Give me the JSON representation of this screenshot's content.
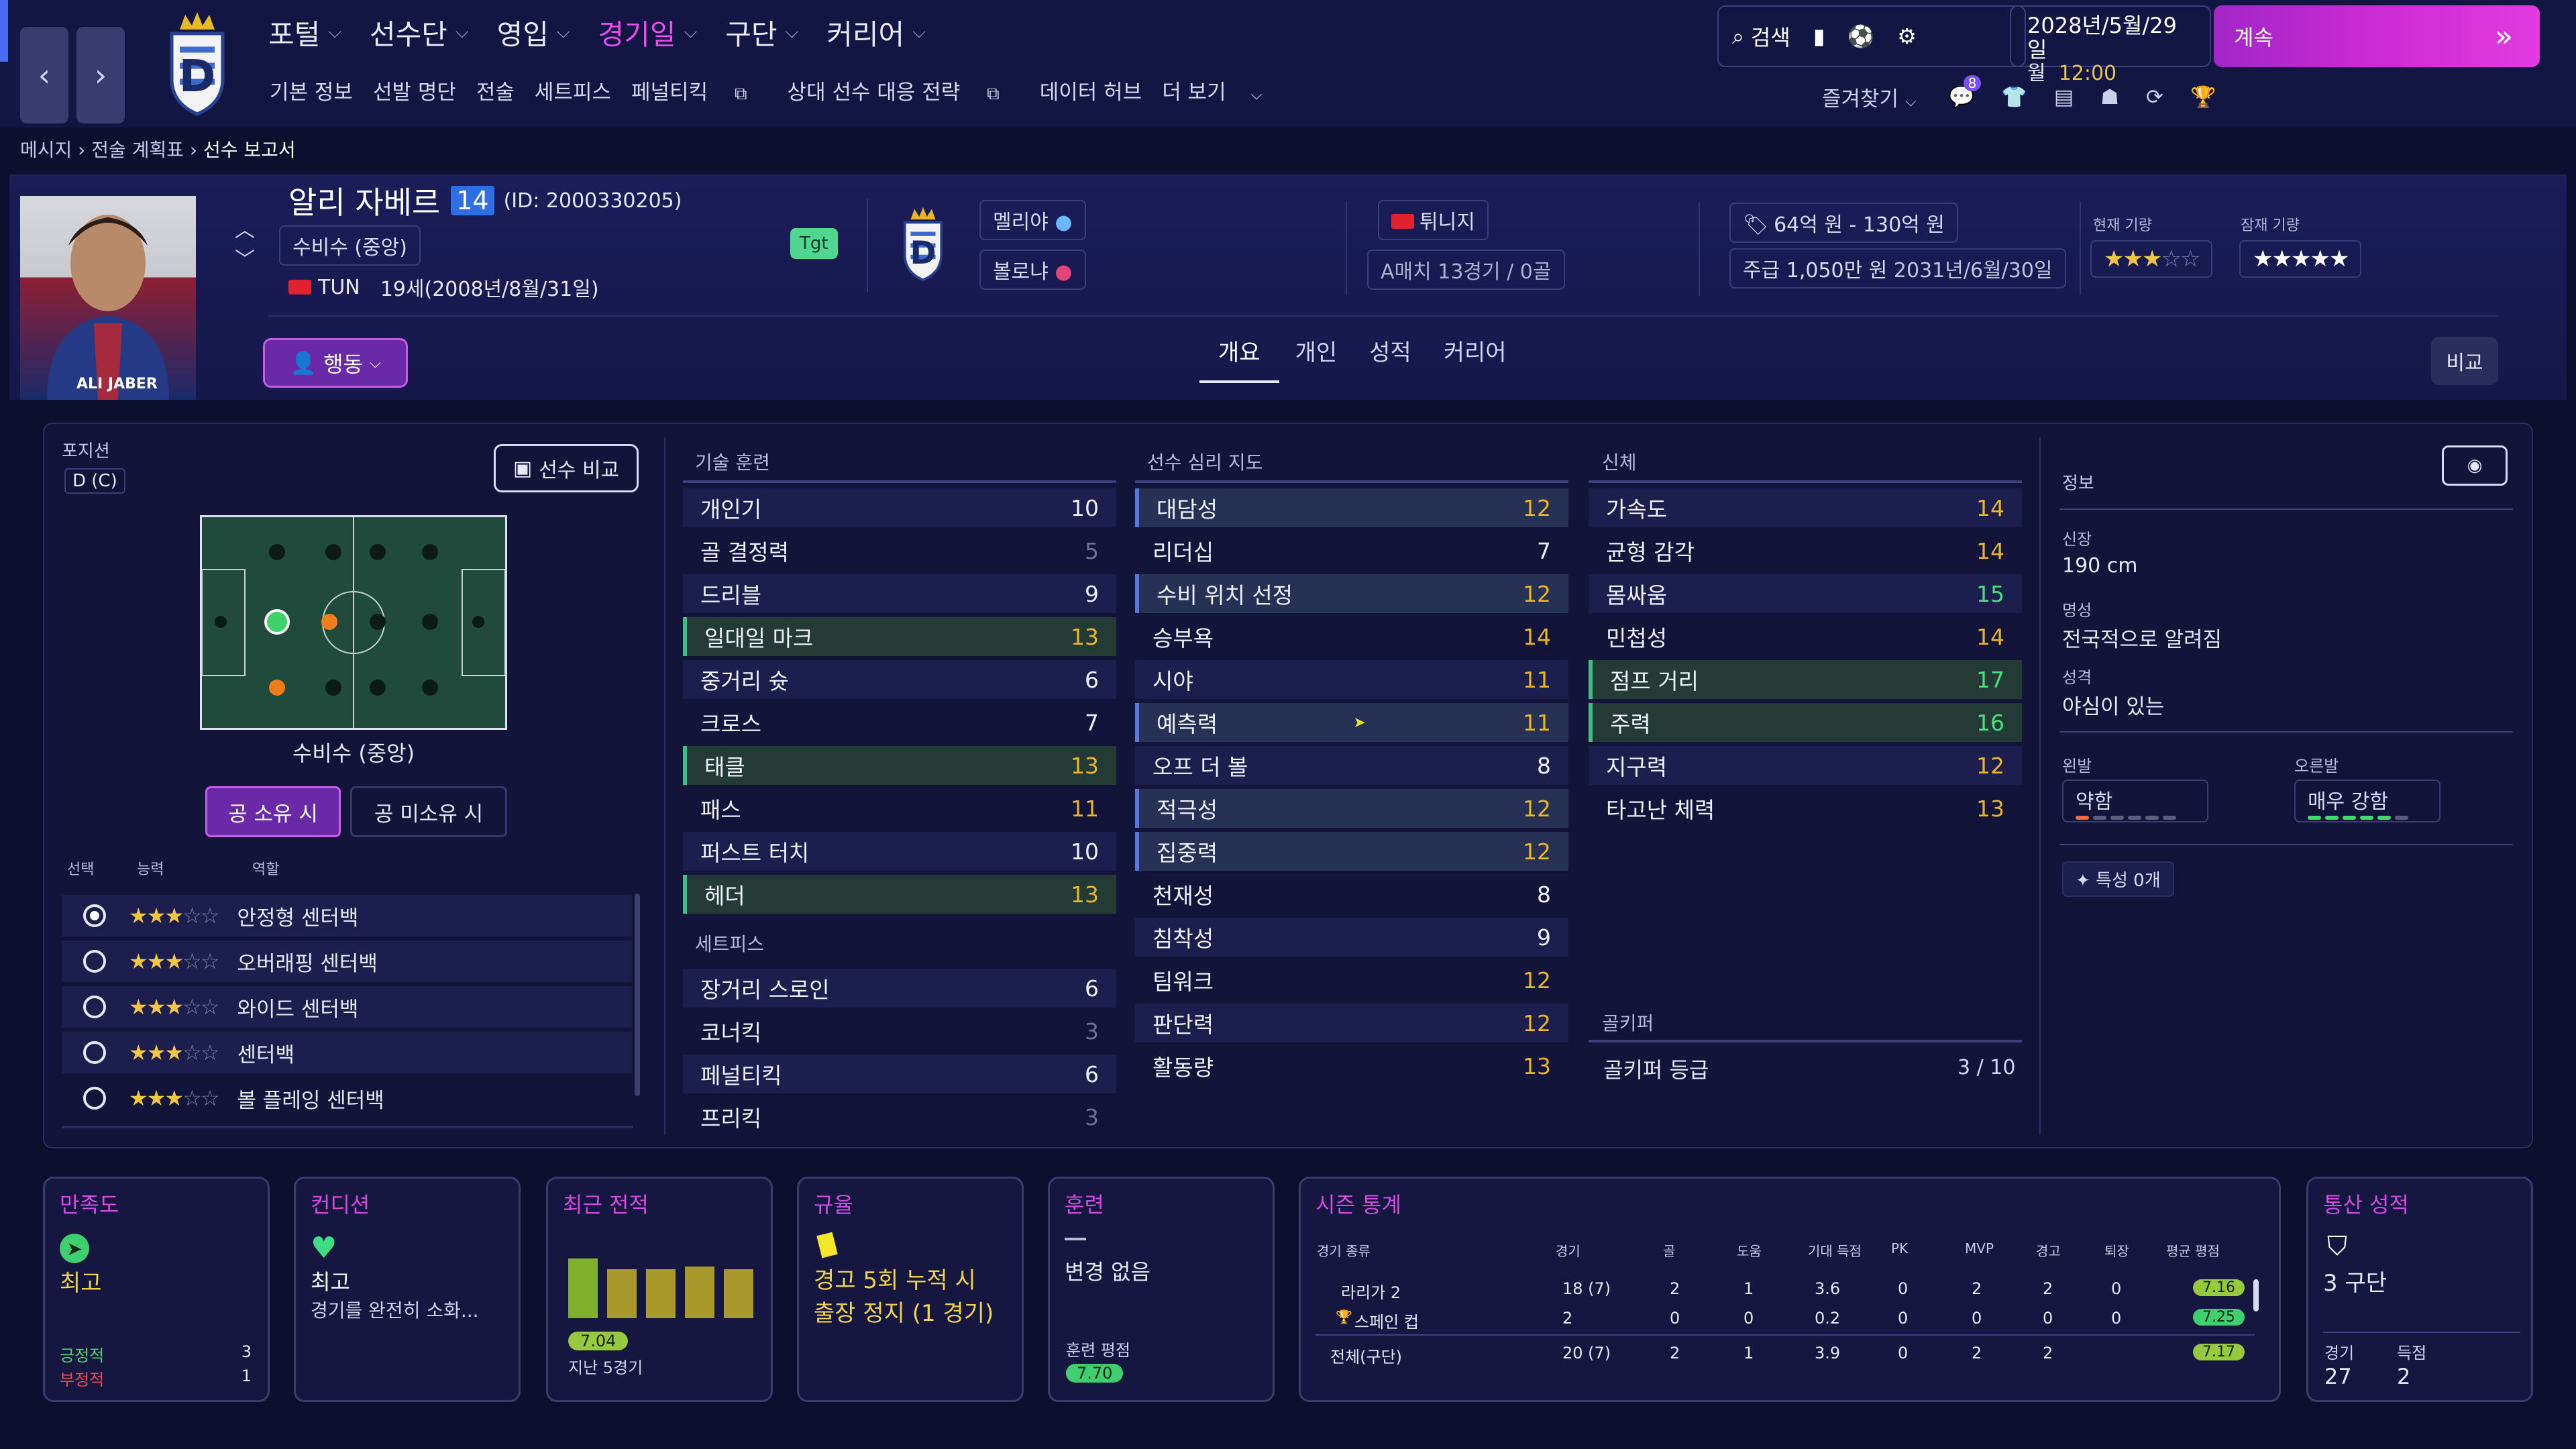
{
  "nav": {
    "back": "‹",
    "forward": "›",
    "main": [
      {
        "label": "포털",
        "active": false
      },
      {
        "label": "선수단",
        "active": false
      },
      {
        "label": "영입",
        "active": false
      },
      {
        "label": "경기일",
        "active": true
      },
      {
        "label": "구단",
        "active": false
      },
      {
        "label": "커리어",
        "active": false
      }
    ],
    "sub": [
      "기본 정보",
      "선발 명단",
      "전술",
      "세트피스",
      "페널티킥",
      "상대 선수 대응 전략",
      "데이터 허브",
      "더 보기"
    ],
    "search": "검색",
    "date": "2028년/5월/29일",
    "weekday": "월",
    "time": "12:00",
    "continue": "계속",
    "favorites": "즐겨찾기",
    "badge": "8"
  },
  "breadcrumb": [
    "메시지",
    "전술 계획표",
    "선수 보고서"
  ],
  "player": {
    "name": "알리 자베르",
    "number": "14",
    "id": "(ID: 2000330205)",
    "position": "수비수 (중앙)",
    "nat_code": "TUN",
    "age": "19세(2008년/8월/31일)",
    "tag": "Tgt",
    "photo_caption": "ALI JABER",
    "action": "행동",
    "club1": "멜리야",
    "club2": "볼로냐",
    "nation": "튀니지",
    "caps": "A매치 13경기 / 0골",
    "value": "64억 원 - 130억 원",
    "wage": "주급 1,050만 원",
    "contract": "2031년/6월/30일",
    "current_ability_label": "현재 기량",
    "potential_label": "잠재 기량",
    "current_ability": 3,
    "potential": 5
  },
  "tabs": [
    {
      "label": "개요",
      "active": true
    },
    {
      "label": "개인",
      "active": false
    },
    {
      "label": "성적",
      "active": false
    },
    {
      "label": "커리어",
      "active": false
    }
  ],
  "compare": "비교",
  "position_panel": {
    "label": "포지션",
    "code": "D (C)",
    "compare_btn": "선수 비교",
    "role_name": "수비수 (중앙)",
    "in_possession": "공 소유 시",
    "out_possession": "공 미소유 시",
    "col_select": "선택",
    "col_ability": "능력",
    "col_role": "역할",
    "roles": [
      {
        "name": "안정형 센터백",
        "stars": 3,
        "selected": true
      },
      {
        "name": "오버래핑 센터백",
        "stars": 3,
        "selected": false
      },
      {
        "name": "와이드 센터백",
        "stars": 3,
        "selected": false
      },
      {
        "name": "센터백",
        "stars": 3,
        "selected": false
      },
      {
        "name": "볼 플레잉 센터백",
        "stars": 3,
        "selected": false
      }
    ]
  },
  "technical": {
    "title": "기술 훈련",
    "items": [
      {
        "n": "개인기",
        "v": "10"
      },
      {
        "n": "골 결정력",
        "v": "5"
      },
      {
        "n": "드리블",
        "v": "9"
      },
      {
        "n": "일대일 마크",
        "v": "13"
      },
      {
        "n": "중거리 슛",
        "v": "6"
      },
      {
        "n": "크로스",
        "v": "7"
      },
      {
        "n": "태클",
        "v": "13"
      },
      {
        "n": "패스",
        "v": "11"
      },
      {
        "n": "퍼스트 터치",
        "v": "10"
      },
      {
        "n": "헤더",
        "v": "13"
      }
    ]
  },
  "setpieces": {
    "title": "세트피스",
    "items": [
      {
        "n": "장거리 스로인",
        "v": "6"
      },
      {
        "n": "코너킥",
        "v": "3"
      },
      {
        "n": "페널티킥",
        "v": "6"
      },
      {
        "n": "프리킥",
        "v": "3"
      }
    ]
  },
  "mental": {
    "title": "선수 심리 지도",
    "items": [
      {
        "n": "대담성",
        "v": "12"
      },
      {
        "n": "리더십",
        "v": "7"
      },
      {
        "n": "수비 위치 선정",
        "v": "12"
      },
      {
        "n": "승부욕",
        "v": "14"
      },
      {
        "n": "시야",
        "v": "11"
      },
      {
        "n": "예측력",
        "v": "11"
      },
      {
        "n": "오프 더 볼",
        "v": "8"
      },
      {
        "n": "적극성",
        "v": "12"
      },
      {
        "n": "집중력",
        "v": "12"
      },
      {
        "n": "천재성",
        "v": "8"
      },
      {
        "n": "침착성",
        "v": "9"
      },
      {
        "n": "팀워크",
        "v": "12"
      },
      {
        "n": "판단력",
        "v": "12"
      },
      {
        "n": "활동량",
        "v": "13"
      }
    ]
  },
  "physical": {
    "title": "신체",
    "items": [
      {
        "n": "가속도",
        "v": "14"
      },
      {
        "n": "균형 감각",
        "v": "14"
      },
      {
        "n": "몸싸움",
        "v": "15"
      },
      {
        "n": "민첩성",
        "v": "14"
      },
      {
        "n": "점프 거리",
        "v": "17"
      },
      {
        "n": "주력",
        "v": "16"
      },
      {
        "n": "지구력",
        "v": "12"
      },
      {
        "n": "타고난 체력",
        "v": "13"
      }
    ]
  },
  "goalkeeper": {
    "title": "골키퍼",
    "label": "골키퍼 등급",
    "value": "3 / 10"
  },
  "info": {
    "title": "정보",
    "height_label": "신장",
    "height": "190 cm",
    "rep_label": "명성",
    "rep": "전국적으로 알려짐",
    "pers_label": "성격",
    "pers": "야심이 있는",
    "left_label": "왼발",
    "left": "약함",
    "right_label": "오른발",
    "right": "매우 강함",
    "left_level": 1,
    "right_level": 5,
    "traits": "특성 0개"
  },
  "bottom": {
    "morale": {
      "title": "만족도",
      "value": "최고",
      "pos_label": "긍정적",
      "pos": "3",
      "neg_label": "부정적",
      "neg": "1"
    },
    "condition": {
      "title": "컨디션",
      "value": "최고",
      "desc": "경기를 완전히 소화..."
    },
    "form": {
      "title": "최근 전적",
      "rating": "7.04",
      "label": "지난 5경기",
      "bars": [
        7.3,
        6.9,
        6.9,
        7.0,
        6.9
      ]
    },
    "discipline": {
      "title": "규율",
      "text1": "경고 5회 누적 시",
      "text2": "출장 정지 (1 경기)"
    },
    "training": {
      "title": "훈련",
      "value": "변경 없음",
      "rating_label": "훈련 평점",
      "rating": "7.70"
    },
    "season": {
      "title": "시즌 통계",
      "cols": [
        "경기 종류",
        "경기",
        "골",
        "도움",
        "기대 득점",
        "PK",
        "MVP",
        "경고",
        "퇴장",
        "평균 평점"
      ],
      "rows": [
        [
          "라리가 2",
          "18 (7)",
          "2",
          "1",
          "3.6",
          "0",
          "2",
          "2",
          "0",
          "7.16"
        ],
        [
          "스페인 컵",
          "2",
          "0",
          "0",
          "0.2",
          "0",
          "0",
          "0",
          "0",
          "7.25"
        ],
        [
          "전체(구단)",
          "20 (7)",
          "2",
          "1",
          "3.9",
          "0",
          "2",
          "2",
          "",
          "7.17"
        ]
      ]
    },
    "career": {
      "title": "통산 성적",
      "value": "3 구단",
      "apps_label": "경기",
      "apps": "27",
      "goals_label": "득점",
      "goals": "2"
    }
  },
  "colors": {
    "accent": "#e84cf0",
    "green": "#49e07a",
    "yellow": "#e9b526",
    "pitch": "#1f4a3c"
  }
}
